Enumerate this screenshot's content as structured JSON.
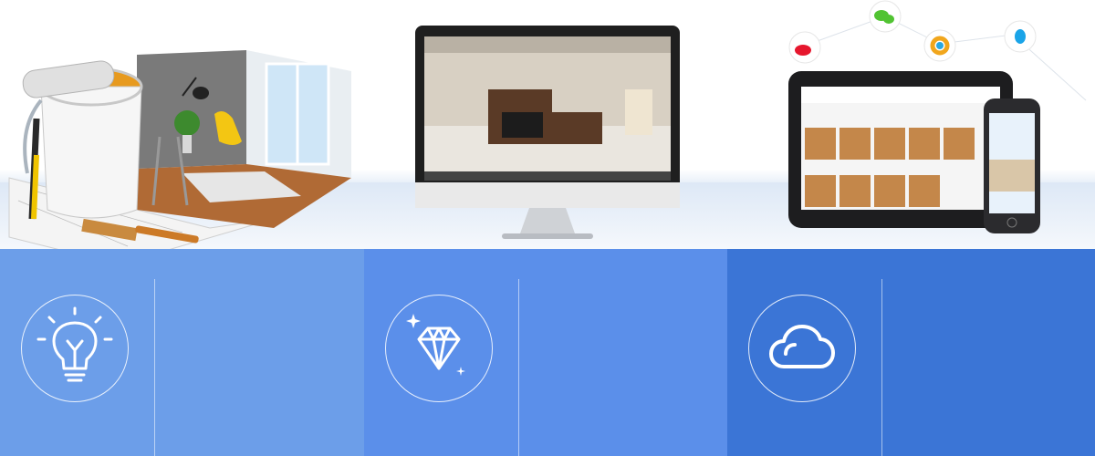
{
  "illustrations": {
    "room": "renovation-room-scene",
    "monitor": "desktop-3d-render",
    "devices": "tablet-and-phone",
    "social_icons": [
      "weibo-icon",
      "wechat-icon",
      "photo-icon",
      "qq-icon"
    ]
  },
  "features": [
    {
      "icon": "lightbulb-icon",
      "color": "#6c9ee9"
    },
    {
      "icon": "diamond-icon",
      "color": "#5b8fea"
    },
    {
      "icon": "cloud-icon",
      "color": "#3b75d6"
    }
  ]
}
